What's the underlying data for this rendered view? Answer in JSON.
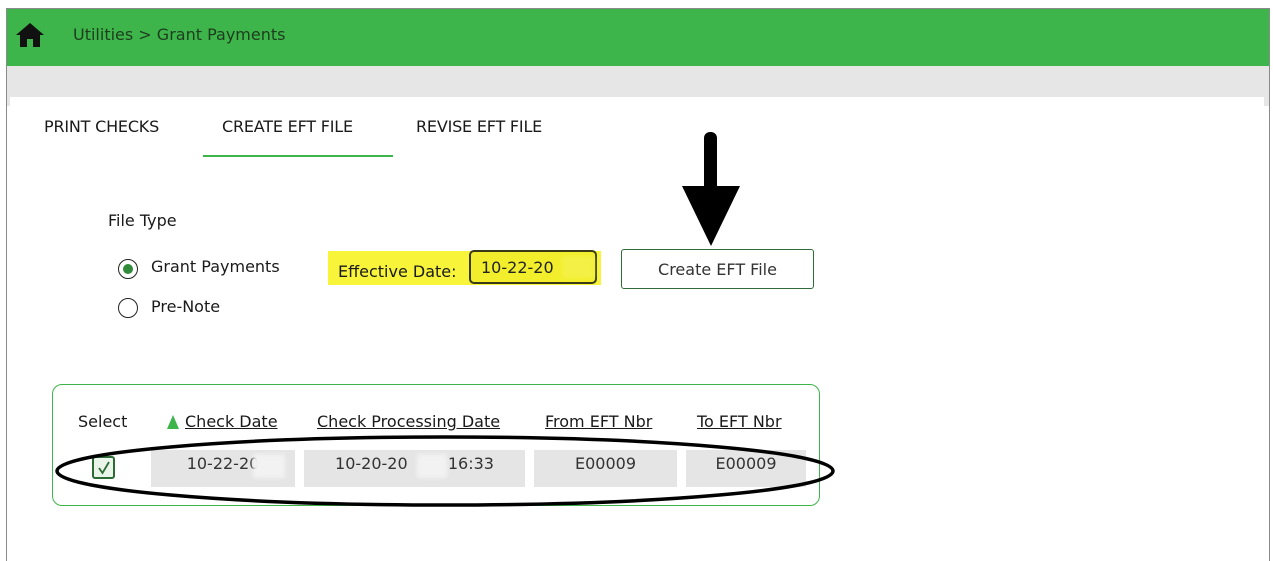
{
  "header": {
    "breadcrumb": "Utilities > Grant Payments",
    "home_icon": "home-icon",
    "bar_color": "#3db54a"
  },
  "tabs": [
    {
      "label": "PRINT CHECKS",
      "active": false
    },
    {
      "label": "CREATE EFT FILE",
      "active": true
    },
    {
      "label": "REVISE EFT FILE",
      "active": false
    }
  ],
  "form": {
    "file_type_label": "File Type",
    "options": [
      {
        "label": "Grant Payments",
        "selected": true
      },
      {
        "label": "Pre-Note",
        "selected": false
      }
    ],
    "effective_date_label": "Effective Date:",
    "effective_date_value": "10-22-20",
    "create_button_label": "Create EFT File"
  },
  "table": {
    "columns": [
      "Select",
      "Check Date",
      "Check Processing Date",
      "From EFT Nbr",
      "To EFT Nbr"
    ],
    "sorted_column": "Check Date",
    "rows": [
      {
        "selected": true,
        "check_date": "10-22-20",
        "check_processing_date": "10-20-20",
        "check_processing_time": "16:33",
        "from_eft_nbr": "E00009",
        "to_eft_nbr": "E00009"
      }
    ]
  }
}
